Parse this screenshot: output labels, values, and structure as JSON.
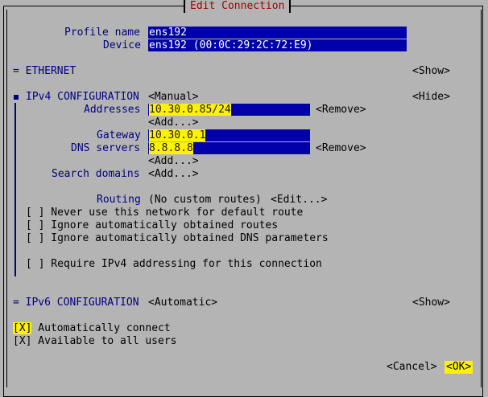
{
  "title": "Edit Connection",
  "profile": {
    "label": "Profile name",
    "value": "ens192"
  },
  "device": {
    "label": "Device",
    "value": "ens192 (00:0C:29:2C:72:E9)"
  },
  "ethernet": {
    "label": "= ETHERNET",
    "action": "<Show>"
  },
  "ipv4": {
    "label": "IPv4 CONFIGURATION",
    "mode": "<Manual>",
    "action": "<Hide>",
    "addresses_label": "Addresses",
    "address_value": "10.30.0.85/24",
    "remove_label": "<Remove>",
    "add_label": "<Add...>",
    "gateway_label": "Gateway",
    "gateway_value": "10.30.0.1",
    "dns_label": "DNS servers",
    "dns_value": "8.8.8.8",
    "search_label": "Search domains",
    "routing_label": "Routing",
    "routing_value": "(No custom routes)",
    "routing_edit": "<Edit...>",
    "never_default": "[ ] Never use this network for default route",
    "ignore_routes": "[ ] Ignore automatically obtained routes",
    "ignore_dns": "[ ] Ignore automatically obtained DNS parameters",
    "require_ipv4": "[ ] Require IPv4 addressing for this connection"
  },
  "ipv6": {
    "label": "= IPv6 CONFIGURATION",
    "mode": "<Automatic>",
    "action": "<Show>"
  },
  "auto_connect": {
    "checkbox": "[X]",
    "label": " Automatically connect"
  },
  "all_users": "[X] Available to all users",
  "buttons": {
    "cancel": "<Cancel>",
    "ok": "<OK>"
  },
  "colors": {
    "background": "#b4b4b4",
    "field": "#0000aa",
    "label": "#000080",
    "title": "#9c0000",
    "highlight": "#fff200"
  }
}
